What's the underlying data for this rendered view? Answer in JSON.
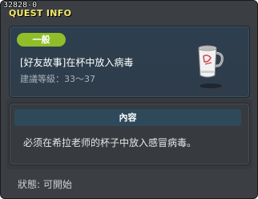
{
  "window": {
    "quest_id": "32828-0",
    "title": "QUEST INFO"
  },
  "quest": {
    "category": "一般",
    "name": "[好友故事]在杯中放入病毒",
    "level_label": "建議等級：33～37",
    "icon": "cup-icon"
  },
  "content": {
    "header": "內容",
    "description": "必须在希拉老师的杯子中放入感冒病毒。"
  },
  "status": {
    "text": "狀態: 可開始"
  },
  "colors": {
    "title": "#f4e86a",
    "badge": "#8fbe2a",
    "panel": "#2f3d4a",
    "header_bar": "#2e4a5a"
  }
}
